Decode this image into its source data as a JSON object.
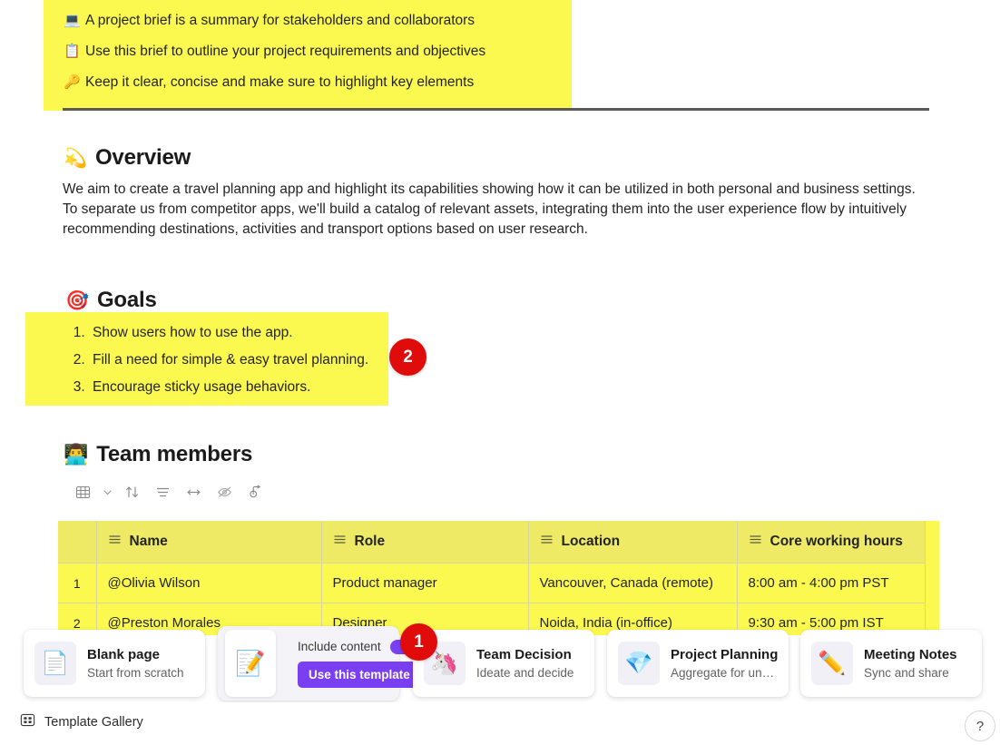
{
  "tips": {
    "items": [
      {
        "emoji": "💻",
        "icon_name": "laptop-icon",
        "text": "A project brief is a summary for stakeholders and collaborators"
      },
      {
        "emoji": "📋",
        "icon_name": "clipboard-icon",
        "text": "Use this brief to outline your project requirements and objectives"
      },
      {
        "emoji": "🔑",
        "icon_name": "key-icon",
        "text": "Keep it clear, concise and make sure to highlight key elements"
      }
    ],
    "highlight_color": "#FBF94F"
  },
  "overview": {
    "emoji": "💫",
    "icon_name": "comet-icon",
    "heading": "Overview",
    "body": "We aim to create a travel planning app and highlight its capabilities showing how it can be utilized in both personal and business settings. To separate us from competitor apps, we'll build a catalog of relevant assets, integrating them into the user experience flow by intuitively recommending destinations, activities and transport options based on user research."
  },
  "goals": {
    "emoji": "🎯",
    "icon_name": "target-icon",
    "heading": "Goals",
    "items": [
      "Show users how to use the app.",
      "Fill a need for simple & easy travel planning.",
      "Encourage sticky usage behaviors."
    ]
  },
  "team": {
    "emoji": "👨‍💻",
    "icon_name": "person-at-laptop-icon",
    "heading": "Team members",
    "toolbar": [
      {
        "name": "table-style-icon",
        "label": "Table style"
      },
      {
        "name": "chevron-down-icon",
        "label": "More table styles"
      },
      {
        "name": "sort-icon",
        "label": "Sort"
      },
      {
        "name": "filter-icon",
        "label": "Filter"
      },
      {
        "name": "fit-width-icon",
        "label": "Fit width"
      },
      {
        "name": "hide-icon",
        "label": "Hide"
      },
      {
        "name": "reset-icon",
        "label": "Reset"
      }
    ],
    "table": {
      "columns": [
        "Name",
        "Role",
        "Location",
        "Core working hours"
      ],
      "rows": [
        {
          "num": "1",
          "name": "@Olivia Wilson",
          "role": "Product manager",
          "location": "Vancouver, Canada (remote)",
          "hours": "8:00 am - 4:00 pm PST"
        },
        {
          "num": "2",
          "name": "@Preston Morales",
          "role": "Designer",
          "location": "Noida, India (in-office)",
          "hours": "9:30 am - 5:00 pm IST"
        }
      ]
    }
  },
  "callouts": [
    {
      "id": "1",
      "label": "1"
    },
    {
      "id": "2",
      "label": "2"
    }
  ],
  "template_strip": {
    "cards": [
      {
        "id": "blank",
        "emoji": "📄",
        "icon_name": "document-icon",
        "title": "Blank page",
        "subtitle": "Start from scratch"
      },
      {
        "id": "team-decision",
        "emoji": "🦄",
        "icon_name": "unicorn-icon",
        "title": "Team Decision",
        "subtitle": "Ideate and decide"
      },
      {
        "id": "project-planning",
        "emoji": "💎",
        "icon_name": "gem-icon",
        "title": "Project Planning",
        "subtitle": "Aggregate for under..."
      },
      {
        "id": "meeting-notes",
        "emoji": "✏️",
        "icon_name": "pencil-icon",
        "title": "Meeting Notes",
        "subtitle": "Sync and share"
      }
    ],
    "active_card": {
      "emoji": "📝",
      "icon_name": "memo-icon",
      "toggle_label": "Include content",
      "toggle_on": true,
      "button_label": "Use this template",
      "accent_color": "#7B3FF2"
    }
  },
  "bottom_bar": {
    "gallery_label": "Template Gallery",
    "gallery_icon": "grid-icon",
    "help_label": "?",
    "help_icon": "question-mark-icon"
  },
  "theme": {
    "highlight_yellow": "#FBF94F",
    "badge_red": "#E00B0B",
    "accent_purple": "#7B3FF2",
    "text_primary": "#242424"
  }
}
